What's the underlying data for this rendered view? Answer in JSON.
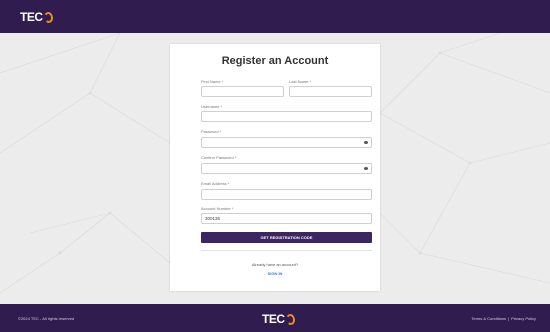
{
  "header": {
    "logo_text": "TEC"
  },
  "form": {
    "title": "Register an Account",
    "first_name": {
      "label": "First Name *",
      "value": ""
    },
    "last_name": {
      "label": "Last Name *",
      "value": ""
    },
    "username": {
      "label": "Username *",
      "value": ""
    },
    "password": {
      "label": "Password *",
      "value": ""
    },
    "confirm_password": {
      "label": "Confirm Password *",
      "value": ""
    },
    "email": {
      "label": "Email Address *",
      "value": ""
    },
    "account_number": {
      "label": "Account Number *",
      "value": "300136"
    },
    "submit_label": "GET REGISTRATION CODE",
    "already_text": "Already have an account?",
    "signin_label": "SIGN IN"
  },
  "footer": {
    "copyright": "©2024 TEC - All rights reserved",
    "logo_text": "TEC",
    "terms_label": "Terms & Conditions",
    "separator": "|",
    "privacy_label": "Privacy Policy"
  },
  "colors": {
    "brand": "#301c4e",
    "accent": "#f08a1c",
    "button": "#3b2562",
    "link": "#3a7bd5"
  }
}
